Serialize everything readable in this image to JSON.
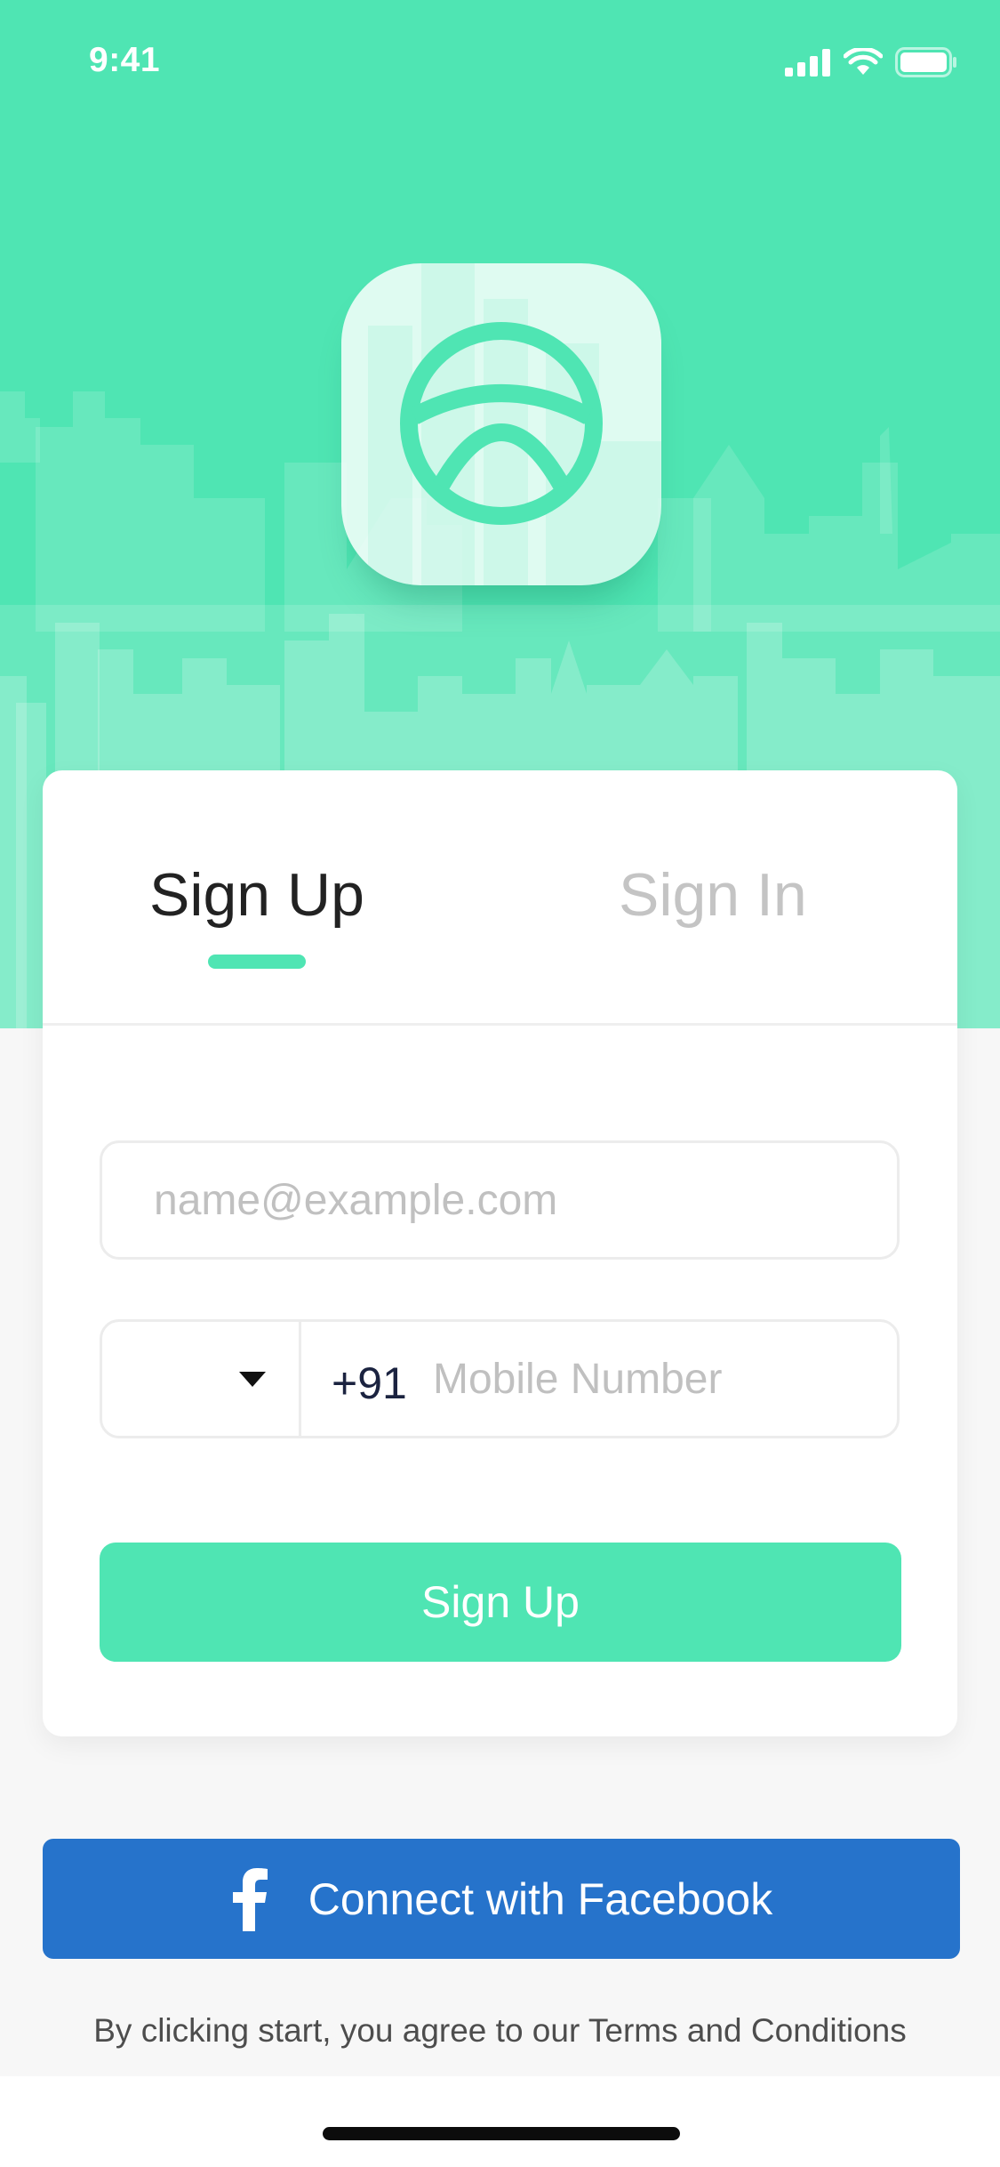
{
  "status_bar": {
    "time": "9:41"
  },
  "tabs": {
    "sign_up": "Sign Up",
    "sign_in": "Sign In"
  },
  "form": {
    "email_placeholder": "name@example.com",
    "dial_code": "+91",
    "mobile_placeholder": "Mobile Number",
    "submit_label": "Sign Up"
  },
  "social": {
    "facebook_label": "Connect with Facebook"
  },
  "footer": {
    "terms_text": "By clicking start, you agree to our Terms and Conditions"
  },
  "colors": {
    "accent": "#4fe5b3",
    "facebook": "#2673cb",
    "background": "#f7f7f7",
    "inactive_tab": "#c4c4c4"
  },
  "icons": [
    "signal-icon",
    "wifi-icon",
    "battery-icon",
    "steering-wheel-icon",
    "caret-down-icon",
    "facebook-icon"
  ]
}
